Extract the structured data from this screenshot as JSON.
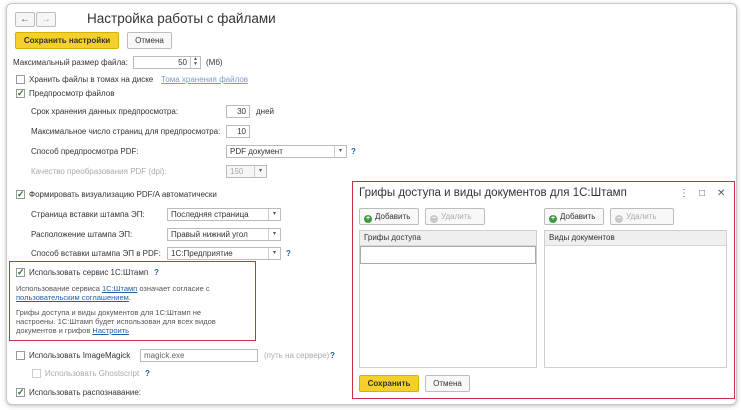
{
  "window": {
    "back_glyph": "←",
    "forward_glyph": "→",
    "title": "Настройка работы с файлами"
  },
  "toolbar": {
    "save_label": "Сохранить настройки",
    "cancel_label": "Отмена"
  },
  "max_size": {
    "label": "Максимальный размер файла:",
    "value": "50",
    "unit": "(Мб)"
  },
  "store_volumes": {
    "label": "Хранить файлы в томах на диске",
    "link": "Тома хранения файлов"
  },
  "preview": {
    "label": "Предпросмотр файлов",
    "retention_label": "Срок хранения данных предпросмотра:",
    "retention_value": "30",
    "retention_unit": "дней",
    "max_pages_label": "Максимальное число страниц для предпросмотра:",
    "max_pages_value": "10",
    "pdf_method_label": "Способ предпросмотра PDF:",
    "pdf_method_value": "PDF документ",
    "quality_label": "Качество преобразования PDF (dpi):",
    "quality_value": "150"
  },
  "pdfa": {
    "label": "Формировать визуализацию PDF/A автоматически",
    "page_label": "Страница вставки штампа ЭП:",
    "page_value": "Последняя страница",
    "position_label": "Расположение штампа ЭП:",
    "position_value": "Правый нижний угол",
    "method_label": "Способ вставки штампа ЭП в PDF:",
    "method_value": "1С:Предприятие"
  },
  "stamp_service": {
    "label": "Использовать сервис 1С:Штамп",
    "agree_pre": "Использование сервиса ",
    "agree_link": "1С:Штамп",
    "agree_mid": " означает согласие с",
    "agree_link2": "пользовательским соглашением",
    "agree_end": ".",
    "note_line1": "Грифы доступа и виды документов для 1С:Штамп не",
    "note_line2": "настроены. 1С:Штамп будет использован для всех видов",
    "note_line3_pre": "документов и грифов ",
    "note_link": "Настроить"
  },
  "imagemagick": {
    "label": "Использовать ImageMagick",
    "value": "magick.exe",
    "hint": "(путь на сервере)"
  },
  "ghostscript": {
    "label": "Использовать Ghostscript"
  },
  "recognition": {
    "label": "Использовать распознавание:"
  },
  "help_glyph": "?",
  "dropdown_glyph": "▾",
  "check_glyph": "✓",
  "dialog": {
    "title": "Грифы доступа и виды документов для 1С:Штамп",
    "menu_glyph": "⋮",
    "maximize_glyph": "□",
    "close_glyph": "✕",
    "left": {
      "add_label": "Добавить",
      "delete_label": "Удалить",
      "column": "Грифы доступа"
    },
    "right": {
      "add_label": "Добавить",
      "delete_label": "Удалить",
      "column": "Виды документов"
    },
    "save_label": "Сохранить",
    "cancel_label": "Отмена"
  },
  "colors": {
    "accent_yellow": "#f4d12a",
    "highlight_red": "#c93040",
    "link_blue": "#1f5fa8",
    "check_green": "#2a7a2a"
  }
}
